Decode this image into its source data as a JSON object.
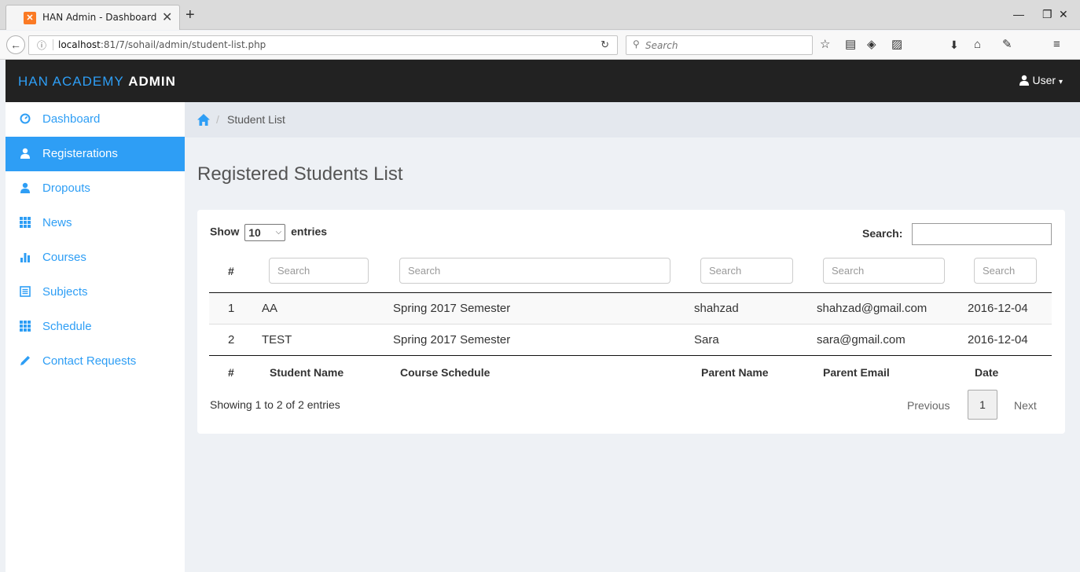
{
  "browser": {
    "tab_title": "HAN Admin - Dashboard",
    "url_host": "localhost",
    "url_rest": ":81/7/sohail/admin/student-list.php",
    "search_placeholder": "Search"
  },
  "navbar": {
    "brand_part1": "HAN ACADEMY",
    "brand_part2": "ADMIN",
    "user_label": "User"
  },
  "sidebar": {
    "items": [
      {
        "label": "Dashboard",
        "icon": "dashboard-icon",
        "active": false
      },
      {
        "label": "Registerations",
        "icon": "user-icon",
        "active": true
      },
      {
        "label": "Dropouts",
        "icon": "user-icon",
        "active": false
      },
      {
        "label": "News",
        "icon": "grid-icon",
        "active": false
      },
      {
        "label": "Courses",
        "icon": "bar-chart-icon",
        "active": false
      },
      {
        "label": "Subjects",
        "icon": "list-icon",
        "active": false
      },
      {
        "label": "Schedule",
        "icon": "grid-icon",
        "active": false
      },
      {
        "label": "Contact Requests",
        "icon": "pencil-icon",
        "active": false
      }
    ]
  },
  "breadcrumb": {
    "current": "Student List"
  },
  "page": {
    "title": "Registered Students List"
  },
  "table": {
    "show_label": "Show",
    "page_length": "10",
    "entries_label": "entries",
    "search_label": "Search:",
    "column_search_placeholder": "Search",
    "columns": [
      "#",
      "Student Name",
      "Course Schedule",
      "Parent Name",
      "Parent Email",
      "Date"
    ],
    "rows": [
      [
        "1",
        "AA",
        "Spring 2017 Semester",
        "shahzad",
        "shahzad@gmail.com",
        "2016-12-04"
      ],
      [
        "2",
        "TEST",
        "Spring 2017 Semester",
        "Sara",
        "sara@gmail.com",
        "2016-12-04"
      ]
    ],
    "info": "Showing 1 to 2 of 2 entries",
    "pagination": {
      "previous": "Previous",
      "current": "1",
      "next": "Next"
    }
  },
  "colors": {
    "accent": "#2e9ef5",
    "navbar_bg": "#222222",
    "page_bg": "#eef1f5"
  }
}
